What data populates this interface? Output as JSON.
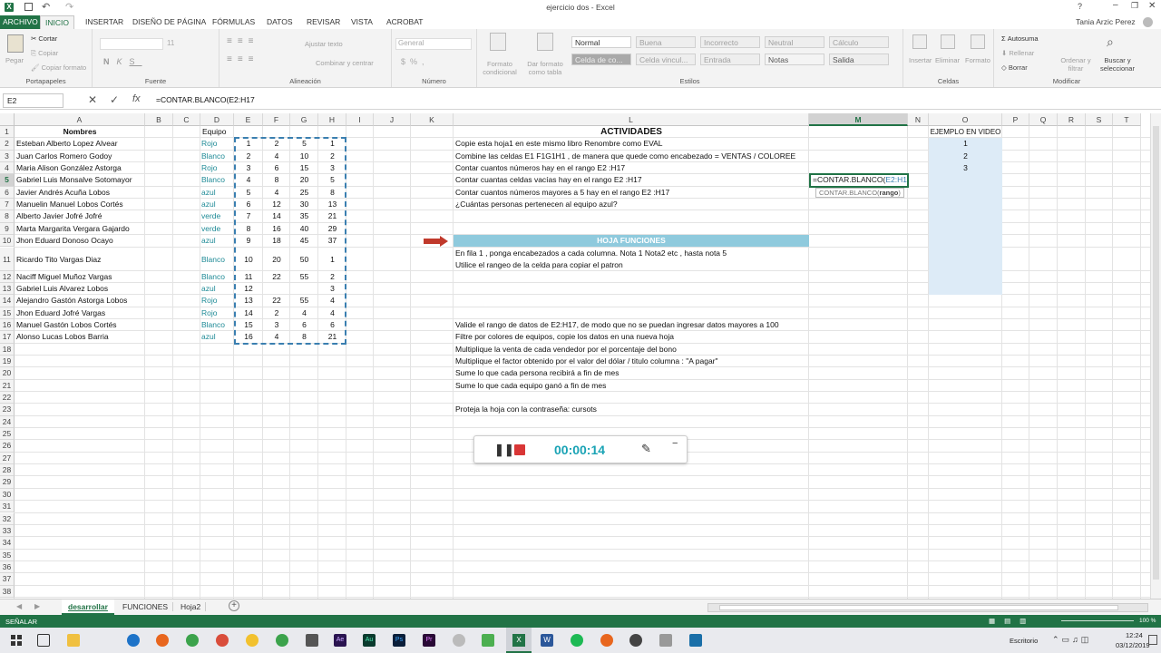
{
  "window": {
    "title": "ejercicio dos - Excel",
    "user": "Tania Arzic Perez",
    "help": "?"
  },
  "menu": {
    "file": "ARCHIVO",
    "tabs": [
      "INICIO",
      "INSERTAR",
      "DISEÑO DE PÁGINA",
      "FÓRMULAS",
      "DATOS",
      "REVISAR",
      "VISTA",
      "ACROBAT"
    ]
  },
  "ribbon": {
    "clipboard": {
      "paste": "Pegar",
      "cut": "Cortar",
      "copy": "Copiar",
      "format_painter": "Copiar formato",
      "label": "Portapapeles"
    },
    "font": {
      "size": "11",
      "label": "Fuente"
    },
    "alignment": {
      "wrap": "Ajustar texto",
      "merge": "Combinar y centrar",
      "label": "Alineación"
    },
    "number": {
      "format": "General",
      "label": "Número"
    },
    "styles": {
      "conditional": "Formato condicional",
      "as_table": "Dar formato como tabla",
      "cells": [
        "Normal",
        "Buena",
        "Incorrecto",
        "Neutral",
        "Cálculo",
        "Celda de co...",
        "Celda vincul...",
        "Entrada",
        "Notas",
        "Salida"
      ],
      "label": "Estilos"
    },
    "cells": {
      "insert": "Insertar",
      "delete": "Eliminar",
      "format": "Formato",
      "label": "Celdas"
    },
    "editing": {
      "autosum": "Autosuma",
      "fill": "Rellenar",
      "clear": "Borrar",
      "sort": "Ordenar y filtrar",
      "find": "Buscar y seleccionar",
      "label": "Modificar"
    }
  },
  "formula_bar": {
    "name_box": "E2",
    "fx": "fx",
    "formula": "=CONTAR.BLANCO(E2:H17"
  },
  "columns": [
    "A",
    "B",
    "C",
    "D",
    "E",
    "F",
    "G",
    "H",
    "I",
    "J",
    "K",
    "L",
    "M",
    "N",
    "O",
    "P",
    "Q",
    "R",
    "S",
    "T"
  ],
  "rows": [
    "1",
    "2",
    "3",
    "4",
    "5",
    "6",
    "7",
    "8",
    "9",
    "10",
    "11",
    "12",
    "13",
    "14",
    "15",
    "16",
    "17",
    "18",
    "19",
    "20",
    "21",
    "22",
    "23",
    "24",
    "25",
    "26",
    "27",
    "28",
    "29",
    "30",
    "31",
    "32",
    "33",
    "34",
    "35",
    "36",
    "37",
    "38"
  ],
  "headers": {
    "names": "Nombres",
    "team": "Equipo",
    "activities": "ACTIVIDADES",
    "video": "EJEMPLO EN VIDEO"
  },
  "people": [
    {
      "name": "Esteban Alberto Lopez Alvear",
      "team": "Rojo",
      "e": "1",
      "f": "2",
      "g": "5",
      "h": "1"
    },
    {
      "name": "Juan Carlos Romero Godoy",
      "team": "Blanco",
      "e": "2",
      "f": "4",
      "g": "10",
      "h": "2"
    },
    {
      "name": "Maria Alison González Astorga",
      "team": "Rojo",
      "e": "3",
      "f": "6",
      "g": "15",
      "h": "3"
    },
    {
      "name": "Gabriel Luis Monsalve Sotomayor",
      "team": "Blanco",
      "e": "4",
      "f": "8",
      "g": "20",
      "h": "5"
    },
    {
      "name": "Javier Andrés Acuña Lobos",
      "team": "azul",
      "e": "5",
      "f": "4",
      "g": "25",
      "h": "8"
    },
    {
      "name": "Manuelin  Manuel Lobos Cortés",
      "team": "azul",
      "e": "6",
      "f": "12",
      "g": "30",
      "h": "13"
    },
    {
      "name": "Alberto Javier Jofré Jofré",
      "team": "verde",
      "e": "7",
      "f": "14",
      "g": "35",
      "h": "21"
    },
    {
      "name": "Marta Margarita  Vergara Gajardo",
      "team": "verde",
      "e": "8",
      "f": "16",
      "g": "40",
      "h": "29"
    },
    {
      "name": "Jhon Eduard Donoso Ocayo",
      "team": "azul",
      "e": "9",
      "f": "18",
      "g": "45",
      "h": "37"
    },
    {
      "name": "Ricardo Tito Vargas Diaz",
      "team": "Blanco",
      "e": "10",
      "f": "20",
      "g": "50",
      "h": "1"
    },
    {
      "name": "Naciff Miguel Muñoz Vargas",
      "team": "Blanco",
      "e": "11",
      "f": "22",
      "g": "55",
      "h": "2"
    },
    {
      "name": "Gabriel Luis Alvarez Lobos",
      "team": "azul",
      "e": "12",
      "f": "",
      "g": "",
      "h": "3"
    },
    {
      "name": "Alejandro Gastón Astorga Lobos",
      "team": "Rojo",
      "e": "13",
      "f": "22",
      "g": "55",
      "h": "4"
    },
    {
      "name": "Jhon Eduard Jofré Vargas",
      "team": "Rojo",
      "e": "14",
      "f": "2",
      "g": "4",
      "h": "4"
    },
    {
      "name": "Manuel Gastón Lobos Cortés",
      "team": "Blanco",
      "e": "15",
      "f": "3",
      "g": "6",
      "h": "6"
    },
    {
      "name": "Alonso Lucas Lobos Barria",
      "team": "azul",
      "e": "16",
      "f": "4",
      "g": "8",
      "h": "21"
    }
  ],
  "activities": [
    "Copie esta hoja1  en este mismo libro  Renombre como EVAL",
    "Combine las celdas E1 F1G1H1 , de manera que quede  como encabezado =  VENTAS / COLOREE",
    "Contar cuantos números hay en el rango E2 :H17",
    "Contar cuantas celdas vacías hay en el rango E2 :H17",
    "Contar cuantos números mayores a 5 hay en el rango E2 :H17",
    "¿Cuántas personas pertenecen al equipo azul?"
  ],
  "funciones": {
    "banner": "HOJA FUNCIONES",
    "lines": [
      "En fila 1 , ponga encabezados a cada columna. Nota 1 Nota2 etc , hasta nota 5",
      "Utilice el rangeo de la celda para copiar el patron"
    ]
  },
  "tasks": [
    "Valide el rango de datos de E2:H17, de modo que no se puedan ingresar datos mayores a 100",
    "Filtre por colores de equipos, copie los datos en una nueva hoja",
    "Multiplique  la venta de cada vendedor por el porcentaje del bono",
    "Multiplique el factor obtenido por el valor del dólar / titulo columna :  \"A pagar\"",
    "Sume lo que cada persona recibirá a fin de mes",
    "Sume lo que cada equipo ganó a fin de mes",
    "Proteja la hoja con la contraseña: cursots"
  ],
  "edit_cell": {
    "formula": "=CONTAR.BLANCO(",
    "range": "E2:H17",
    "tooltip": "CONTAR.BLANCO(",
    "tooltip_arg": "rango",
    "tooltip_end": ")"
  },
  "video_examples": [
    "1",
    "2",
    "3"
  ],
  "sheets": [
    "desarrollar",
    "FUNCIONES",
    "Hoja2"
  ],
  "status": {
    "mode": "SEÑALAR",
    "zoom": "100 %"
  },
  "recorder": {
    "time": "00:00:14"
  },
  "taskbar": {
    "desktop": "Escritorio",
    "time": "12:24",
    "date": "03/12/2019"
  },
  "colors": {
    "excel_green": "#217346",
    "team_text": "#1e8a96",
    "banner": "#8fcadd",
    "video_fill": "#ddebf7",
    "arrow": "#c0392b",
    "timer": "#1aa3b5"
  }
}
